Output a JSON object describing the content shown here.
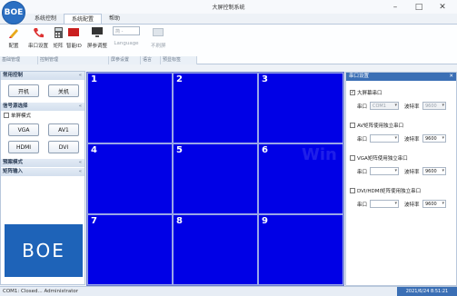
{
  "window": {
    "logo_text": "BOE",
    "title": "大屏控制系统",
    "minimize": "–",
    "maximize": "□",
    "close": "✕"
  },
  "ribbon": {
    "tabs": [
      "系统控制",
      "系统配置",
      "帮助"
    ],
    "active_tab": 1,
    "buttons": [
      {
        "label": "配置",
        "icon": "pencil-icon"
      },
      {
        "label": "串口设置",
        "icon": "phone-icon"
      },
      {
        "label": "矩阵",
        "icon": "calculator-icon"
      },
      {
        "label": "智能ID",
        "icon": "red-card-icon"
      },
      {
        "label": "屏参调整",
        "icon": "monitor-icon"
      },
      {
        "label": "Language",
        "icon": "language-dropdown",
        "value": "简 -",
        "disabled": true
      },
      {
        "label": "不刷屏",
        "icon": "screen-icon",
        "disabled": true
      }
    ],
    "groups": [
      "基础管理",
      "控制管理",
      "屏参设置",
      "语言",
      "预显标签"
    ]
  },
  "left_panel": {
    "sections": [
      {
        "title": "常用控制"
      },
      {
        "title": "信号源选择"
      },
      {
        "title": "预案模式"
      },
      {
        "title": "矩阵输入"
      }
    ],
    "power_on": "开机",
    "power_off": "关机",
    "single_screen_mode": "单屏模式",
    "sources": [
      "VGA",
      "AV1",
      "HDMI",
      "DVI"
    ],
    "logo": "BOE"
  },
  "grid": {
    "cells": [
      "1",
      "2",
      "3",
      "4",
      "5",
      "6",
      "7",
      "8",
      "9"
    ],
    "watermark": "Win"
  },
  "right_panel": {
    "title": "串口设置",
    "big_screen_serial": {
      "label": "大屏幕串口",
      "checked": true
    },
    "serial_label": "串口",
    "serial_value": "COM1",
    "baud_label": "波特率",
    "baud_value_disabled": "9600",
    "av_matrix": {
      "label": "AV矩阵使用独立串口",
      "checked": false
    },
    "vga_matrix": {
      "label": "VGA矩阵使用独立串口",
      "checked": false
    },
    "dvi_matrix": {
      "label": "DVI/HDMI矩阵使用独立串口",
      "checked": false
    },
    "baud_value": "9600"
  },
  "status_bar": {
    "left": "COM1: Closed...  Administrator",
    "right": "2021/6/24 8:51:21"
  },
  "colors": {
    "grid_bg": "#0000e6",
    "accent": "#3b6fb5",
    "logo_bg": "#1e63b8"
  }
}
